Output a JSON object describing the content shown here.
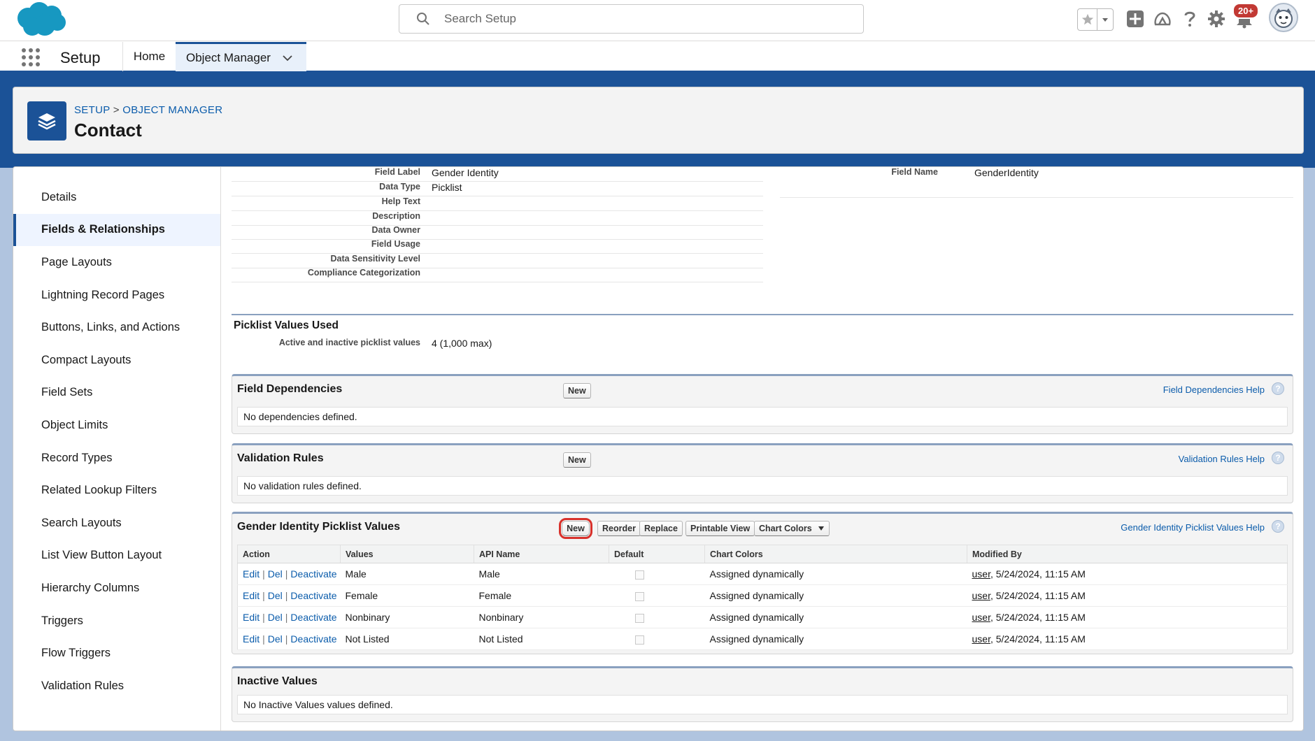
{
  "header": {
    "search_placeholder": "Search Setup",
    "notification_count": "20+",
    "icons": [
      "salesforce-cloud-logo",
      "search-icon",
      "favorites-star-icon",
      "chevron-down-icon",
      "add-icon",
      "trailhead-icon",
      "help-icon",
      "gear-icon",
      "bell-icon",
      "avatar"
    ]
  },
  "context_bar": {
    "app_name": "Setup",
    "home_label": "Home",
    "object_manager_label": "Object Manager"
  },
  "page_header": {
    "breadcrumb_setup": "SETUP",
    "breadcrumb_sep": ">",
    "breadcrumb_om": "OBJECT MANAGER",
    "title": "Contact"
  },
  "sidebar": {
    "items": [
      {
        "label": "Details"
      },
      {
        "label": "Fields & Relationships"
      },
      {
        "label": "Page Layouts"
      },
      {
        "label": "Lightning Record Pages"
      },
      {
        "label": "Buttons, Links, and Actions"
      },
      {
        "label": "Compact Layouts"
      },
      {
        "label": "Field Sets"
      },
      {
        "label": "Object Limits"
      },
      {
        "label": "Record Types"
      },
      {
        "label": "Related Lookup Filters"
      },
      {
        "label": "Search Layouts"
      },
      {
        "label": "List View Button Layout"
      },
      {
        "label": "Hierarchy Columns"
      },
      {
        "label": "Triggers"
      },
      {
        "label": "Flow Triggers"
      },
      {
        "label": "Validation Rules"
      }
    ],
    "active_index": 1
  },
  "field_detail": {
    "rows": [
      {
        "label": "Field Label",
        "value": "Gender Identity"
      },
      {
        "label": "Data Type",
        "value": "Picklist"
      },
      {
        "label": "Help Text",
        "value": ""
      },
      {
        "label": "Description",
        "value": ""
      },
      {
        "label": "Data Owner",
        "value": ""
      },
      {
        "label": "Field Usage",
        "value": ""
      },
      {
        "label": "Data Sensitivity Level",
        "value": ""
      },
      {
        "label": "Compliance Categorization",
        "value": ""
      }
    ],
    "field_name_label": "Field Name",
    "field_name_value": "GenderIdentity"
  },
  "picklist_values_used": {
    "title": "Picklist Values Used",
    "label": "Active and inactive picklist values",
    "value": "4 (1,000 max)"
  },
  "field_dependencies": {
    "title": "Field Dependencies",
    "new_label": "New",
    "help_label": "Field Dependencies Help",
    "empty_text": "No dependencies defined."
  },
  "validation_rules": {
    "title": "Validation Rules",
    "new_label": "New",
    "help_label": "Validation Rules Help",
    "empty_text": "No validation rules defined."
  },
  "picklist_values": {
    "title": "Gender Identity Picklist Values",
    "buttons": {
      "new": "New",
      "reorder": "Reorder",
      "replace": "Replace",
      "printable_view": "Printable View",
      "chart_colors": "Chart Colors"
    },
    "help_label": "Gender Identity Picklist Values Help",
    "columns": [
      "Action",
      "Values",
      "API Name",
      "Default",
      "Chart Colors",
      "Modified By"
    ],
    "action_links": {
      "edit": "Edit",
      "del": "Del",
      "deactivate": "Deactivate",
      "sep": "|"
    },
    "rows": [
      {
        "value": "Male",
        "api_name": "Male",
        "default": false,
        "chart_colors": "Assigned dynamically",
        "modified_user": "user",
        "modified_date": ", 5/24/2024, 11:15 AM"
      },
      {
        "value": "Female",
        "api_name": "Female",
        "default": false,
        "chart_colors": "Assigned dynamically",
        "modified_user": "user",
        "modified_date": ", 5/24/2024, 11:15 AM"
      },
      {
        "value": "Nonbinary",
        "api_name": "Nonbinary",
        "default": false,
        "chart_colors": "Assigned dynamically",
        "modified_user": "user",
        "modified_date": ", 5/24/2024, 11:15 AM"
      },
      {
        "value": "Not Listed",
        "api_name": "Not Listed",
        "default": false,
        "chart_colors": "Assigned dynamically",
        "modified_user": "user",
        "modified_date": ", 5/24/2024, 11:15 AM"
      }
    ]
  },
  "inactive_values": {
    "title": "Inactive Values",
    "empty_text": "No Inactive Values values defined."
  },
  "colors": {
    "brand_blue": "#1b5297",
    "link_blue": "#0b5cab",
    "highlight_red": "#d8312b",
    "notification_red": "#c23934"
  }
}
